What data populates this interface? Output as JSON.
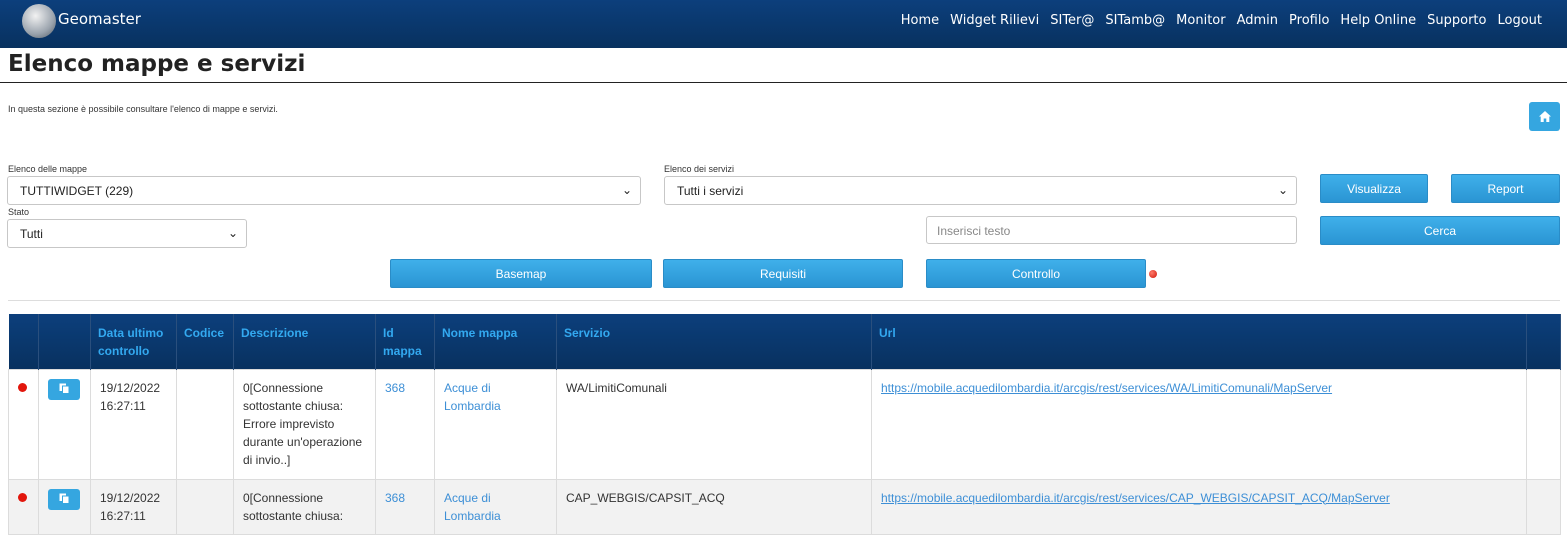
{
  "app": {
    "brand": "Geomaster"
  },
  "nav": [
    "Home",
    "Widget Rilievi",
    "SITer@",
    "SITamb@",
    "Monitor",
    "Admin",
    "Profilo",
    "Help Online",
    "Supporto",
    "Logout"
  ],
  "page": {
    "title": "Elenco mappe e servizi",
    "intro": "In questa sezione è possibile consultare l'elenco di mappe e servizi."
  },
  "filters": {
    "maps_label": "Elenco delle mappe",
    "maps_value": "TUTTIWIDGET (229)",
    "services_label": "Elenco dei servizi",
    "services_value": "Tutti i servizi",
    "state_label": "Stato",
    "state_value": "Tutti",
    "search_placeholder": "Inserisci testo"
  },
  "buttons": {
    "visualizza": "Visualizza",
    "report": "Report",
    "cerca": "Cerca",
    "basemap": "Basemap",
    "requisiti": "Requisiti",
    "controllo": "Controllo"
  },
  "table": {
    "headers": [
      "",
      "",
      "Data ultimo controllo",
      "Codice",
      "Descrizione",
      "Id mappa",
      "Nome mappa",
      "Servizio",
      "Url",
      ""
    ],
    "rows": [
      {
        "date": "19/12/2022 16:27:11",
        "code": "",
        "description": "0[Connessione sottostante chiusa: Errore imprevisto durante un'operazione di invio..]",
        "map_id": "368",
        "map_name": "Acque di Lombardia",
        "service": "WA/LimitiComunali",
        "url": "https://mobile.acquedilombardia.it/arcgis/rest/services/WA/LimitiComunali/MapServer"
      },
      {
        "date": "19/12/2022 16:27:11",
        "code": "",
        "description": "0[Connessione sottostante chiusa:",
        "map_id": "368",
        "map_name": "Acque di Lombardia",
        "service": "CAP_WEBGIS/CAPSIT_ACQ",
        "url": "https://mobile.acquedilombardia.it/arcgis/rest/services/CAP_WEBGIS/CAPSIT_ACQ/MapServer"
      }
    ]
  },
  "icons": {
    "home": "home-icon",
    "copy": "copy-icon",
    "status": "status-dot-icon"
  },
  "colors": {
    "header": "#0c3f7c",
    "button": "#35a6e0",
    "link": "#3d8fd6",
    "error": "#e2160c"
  }
}
